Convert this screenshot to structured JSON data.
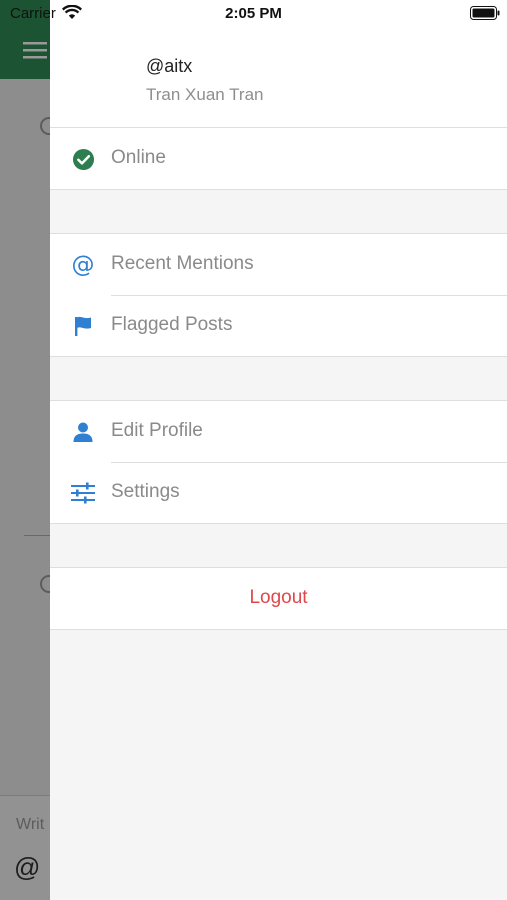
{
  "status_bar": {
    "carrier": "Carrier",
    "time": "2:05 PM"
  },
  "background_app": {
    "header_color": "#2f8a54",
    "input_placeholder": "Writ",
    "at_symbol": "@"
  },
  "profile": {
    "username": "@aitx",
    "full_name": "Tran Xuan Tran"
  },
  "status": {
    "label": "Online",
    "icon": "check-circle-icon",
    "color": "#2e7d4f"
  },
  "menu": {
    "recent_mentions": {
      "label": "Recent Mentions",
      "icon": "at-icon"
    },
    "flagged_posts": {
      "label": "Flagged Posts",
      "icon": "flag-icon"
    },
    "edit_profile": {
      "label": "Edit Profile",
      "icon": "user-icon"
    },
    "settings": {
      "label": "Settings",
      "icon": "sliders-icon"
    }
  },
  "logout": {
    "label": "Logout",
    "color": "#e0474a"
  },
  "colors": {
    "accent_blue": "#2f7fd3",
    "label_gray": "#8a8a8a",
    "drawer_bg": "#f5f5f5"
  }
}
